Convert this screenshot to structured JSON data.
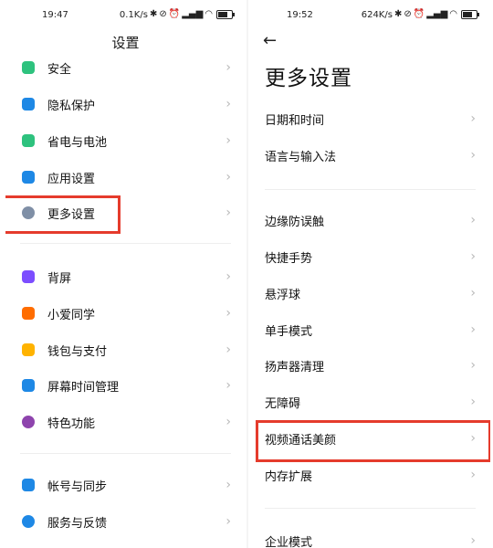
{
  "left": {
    "status": {
      "time": "19:47",
      "speed": "0.1K/s"
    },
    "title": "设置",
    "items": [
      {
        "label": "安全",
        "icon": "shield-icon",
        "color": "#2ec27e"
      },
      {
        "label": "隐私保护",
        "icon": "privacy-icon",
        "color": "#1e88e5"
      },
      {
        "label": "省电与电池",
        "icon": "battery-icon",
        "color": "#2ec27e"
      },
      {
        "label": "应用设置",
        "icon": "gear-icon",
        "color": "#1e88e5"
      },
      {
        "label": "更多设置",
        "icon": "more-icon",
        "color": "#7f8fa6"
      },
      {
        "label": "背屏",
        "icon": "rear-screen-icon",
        "color": "#7c4dff"
      },
      {
        "label": "小爱同学",
        "icon": "xiaoai-icon",
        "color": "#ff6d00"
      },
      {
        "label": "钱包与支付",
        "icon": "wallet-icon",
        "color": "#ffb300"
      },
      {
        "label": "屏幕时间管理",
        "icon": "screen-time-icon",
        "color": "#1e88e5"
      },
      {
        "label": "特色功能",
        "icon": "feature-icon",
        "color": "#8e44ad"
      },
      {
        "label": "帐号与同步",
        "icon": "account-icon",
        "color": "#1e88e5"
      },
      {
        "label": "服务与反馈",
        "icon": "help-icon",
        "color": "#1e88e5"
      }
    ]
  },
  "right": {
    "status": {
      "time": "19:52",
      "speed": "624K/s"
    },
    "title": "更多设置",
    "items": [
      {
        "label": "日期和时间"
      },
      {
        "label": "语言与输入法"
      },
      {
        "label": "边缘防误触"
      },
      {
        "label": "快捷手势"
      },
      {
        "label": "悬浮球"
      },
      {
        "label": "单手模式"
      },
      {
        "label": "扬声器清理"
      },
      {
        "label": "无障碍"
      },
      {
        "label": "视频通话美颜"
      },
      {
        "label": "内存扩展"
      },
      {
        "label": "企业模式"
      }
    ]
  },
  "chevron": "›",
  "back": "←",
  "highlight_color": "#e53b2c"
}
